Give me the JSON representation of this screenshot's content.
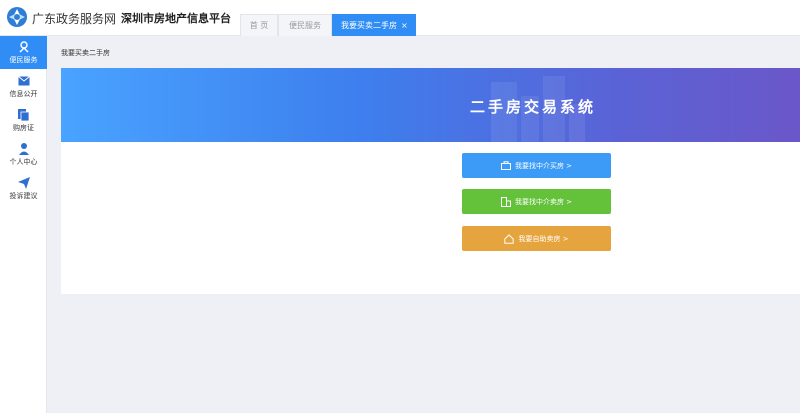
{
  "header": {
    "brand": "广东政务服务网",
    "platform": "深圳市房地产信息平台"
  },
  "tabs": [
    {
      "label": "首 页"
    },
    {
      "label": "便民服务"
    },
    {
      "label": "我要买卖二手房",
      "close": "×"
    }
  ],
  "sidebar": {
    "items": [
      {
        "label": "便民服务",
        "icon": "service-icon"
      },
      {
        "label": "信息公开",
        "icon": "mail-icon"
      },
      {
        "label": "购房证",
        "icon": "document-icon"
      },
      {
        "label": "个人中心",
        "icon": "user-icon"
      },
      {
        "label": "投诉建议",
        "icon": "send-icon"
      }
    ]
  },
  "breadcrumb": "我要买卖二手房",
  "banner": {
    "title": "二手房交易系统"
  },
  "actions": [
    {
      "label": "我要找中介买房 >",
      "icon": "bag-icon",
      "color": "#3c9bf7"
    },
    {
      "label": "我要找中介卖房 >",
      "icon": "building-icon",
      "color": "#64c13a"
    },
    {
      "label": "我要自助卖房 >",
      "icon": "house-icon",
      "color": "#e6a43e"
    }
  ],
  "colors": {
    "accent": "#2f8df5"
  }
}
